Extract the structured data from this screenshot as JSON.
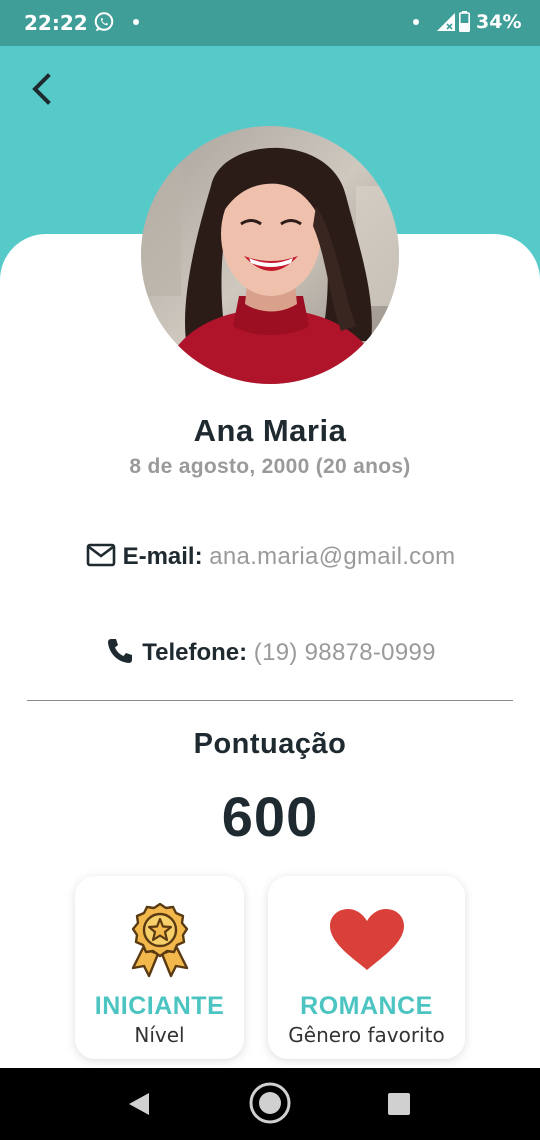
{
  "status_bar": {
    "time": "22:22",
    "battery": "34%",
    "icons": [
      "whatsapp-icon",
      "dot-icon",
      "dot-icon",
      "signal-icon",
      "battery-icon"
    ]
  },
  "colors": {
    "status_bar": "#409e98",
    "header": "#56cac9",
    "accent": "#4cc4c2",
    "heart": "#d9403a",
    "medal": "#f2b84b",
    "text_dark": "#1f2a30",
    "text_muted": "#9a9a9a"
  },
  "profile": {
    "name": "Ana Maria",
    "birth": "8 de agosto, 2000 (20 anos)",
    "email_label": "E-mail:",
    "email": "ana.maria@gmail.com",
    "phone_label": "Telefone:",
    "phone": "(19) 98878-0999"
  },
  "score": {
    "title": "Pontuação",
    "value": "600"
  },
  "badges": [
    {
      "icon": "medal-icon",
      "title": "INICIANTE",
      "subtitle": "Nível"
    },
    {
      "icon": "heart-icon",
      "title": "ROMANCE",
      "subtitle": "Gênero favorito"
    }
  ],
  "nav": [
    "back-triangle-icon",
    "home-circle-icon",
    "recents-square-icon"
  ]
}
